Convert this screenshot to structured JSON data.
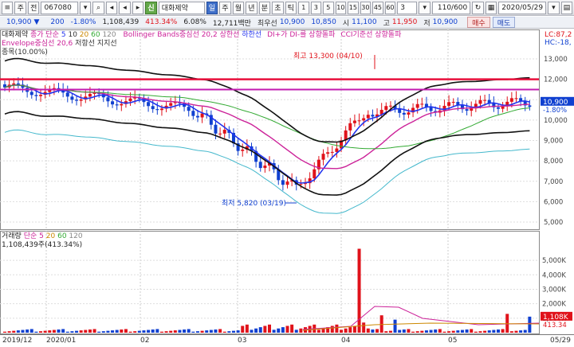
{
  "toolbar": {
    "stock_code": "067080",
    "stock_name": "대화제약",
    "btn_main": "주",
    "btn_prev": "전",
    "shin_label": "신",
    "period_tabs": [
      "일",
      "주",
      "월",
      "년",
      "분",
      "초",
      "틱"
    ],
    "active_period": "일",
    "intervals": [
      "1",
      "3",
      "5",
      "10",
      "15",
      "30",
      "45",
      "60"
    ],
    "interval_sel": "3",
    "count_display": "110/600",
    "date": "2020/05/29"
  },
  "quote": {
    "price": "10,900",
    "change": "200",
    "change_pct": "-1.80%",
    "volume": "1,108,439",
    "vol_ratio": "413.34%",
    "turnover": "6.08%",
    "amount": "12,711백만",
    "best_label": "최우선",
    "best_ask": "10,900",
    "best_bid": "10,850",
    "open_label": "시",
    "open": "11,100",
    "high_label": "고",
    "high": "11,950",
    "low_label": "저",
    "low": "10,900",
    "buy_label": "매수",
    "sell_label": "매도"
  },
  "legend_price": {
    "name": "대화제약",
    "ma": "종가 단순",
    "ma_periods": [
      "5",
      "10",
      "20",
      "60",
      "120"
    ],
    "bollinger": "Bollinger Bands중심선 20,2",
    "upper": "상한선",
    "lower": "하한선",
    "dmi": "DI+가 DI-를 상향돌파",
    "cci": "CCI기준선 상향돌파",
    "envelope": "Envelope중심선 20,6",
    "resist": "저항선",
    "support": "지지선",
    "tag": "종목(10.00%)",
    "lc": "LC:87,2",
    "hc": "HC:-18,"
  },
  "legend_volume": {
    "name": "거래량",
    "ma": "단순",
    "ma_periods": [
      "5",
      "20",
      "60",
      "120"
    ],
    "value": "1,108,439주(413.34%)"
  },
  "annotations": {
    "high": "최고 13,300 (04/10)",
    "low": "최저 5,820 (03/19)"
  },
  "price_axis": [
    "13,000",
    "12,000",
    "11,000",
    "10,000",
    "9,000",
    "8,000",
    "7,000",
    "6,000",
    "5,000"
  ],
  "price_tags": {
    "last": "10,900",
    "pct": "-1.80%"
  },
  "volume_axis": [
    "5,000K",
    "4,000K",
    "3,000K",
    "2,000K",
    "1,000K"
  ],
  "volume_tags": {
    "last": "1,108K",
    "pct": "413.34"
  },
  "dates": [
    "2019/12",
    "2020/01",
    "02",
    "03",
    "04",
    "05",
    "05/29"
  ],
  "colors": {
    "up": "#e0121a",
    "down": "#1040d0",
    "ma5": "#2233ee",
    "ma20": "#cc2299",
    "ma60": "#33aa33",
    "bb": "#111111"
  }
}
